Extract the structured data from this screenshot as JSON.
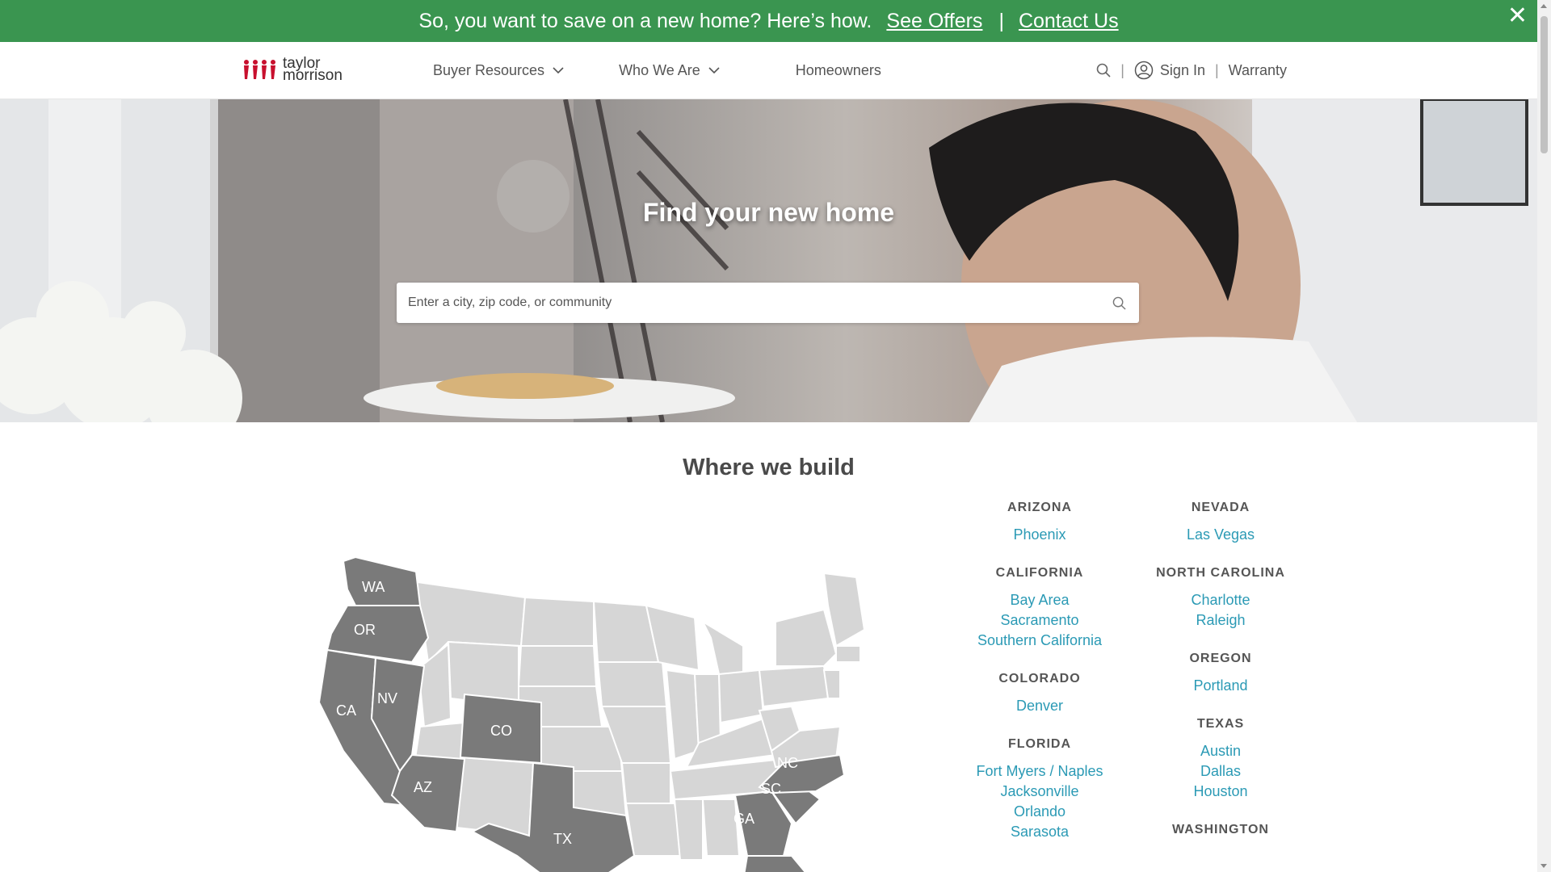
{
  "promo": {
    "text": "So, you want to save on a new home? Here’s how.",
    "offers_link": "See Offers",
    "separator": "|",
    "contact_link": "Contact Us",
    "close_glyph": "✕"
  },
  "header": {
    "logo_line1": "taylor",
    "logo_line2": "morrison",
    "nav": [
      {
        "label": "Buyer Resources"
      },
      {
        "label": "Who We Are"
      },
      {
        "label": "Homeowners"
      }
    ],
    "signin_label": "Sign In",
    "warranty_label": "Warranty"
  },
  "hero": {
    "title": "Find your new home",
    "search_placeholder": "Enter a city, zip code, or community"
  },
  "where_we_build": {
    "title": "Where we build",
    "map_highlighted_states": [
      "WA",
      "OR",
      "CA",
      "NV",
      "AZ",
      "CO",
      "TX",
      "GA",
      "SC",
      "NC"
    ],
    "col1": [
      {
        "state": "ARIZONA",
        "cities": [
          "Phoenix"
        ]
      },
      {
        "state": "CALIFORNIA",
        "cities": [
          "Bay Area",
          "Sacramento",
          "Southern California"
        ]
      },
      {
        "state": "COLORADO",
        "cities": [
          "Denver"
        ]
      },
      {
        "state": "FLORIDA",
        "cities": [
          "Fort Myers / Naples",
          "Jacksonville",
          "Orlando",
          "Sarasota"
        ]
      }
    ],
    "col2": [
      {
        "state": "NEVADA",
        "cities": [
          "Las Vegas"
        ]
      },
      {
        "state": "NORTH CAROLINA",
        "cities": [
          "Charlotte",
          "Raleigh"
        ]
      },
      {
        "state": "OREGON",
        "cities": [
          "Portland"
        ]
      },
      {
        "state": "TEXAS",
        "cities": [
          "Austin",
          "Dallas",
          "Houston"
        ]
      },
      {
        "state": "WASHINGTON",
        "cities": []
      }
    ]
  },
  "colors": {
    "banner_green": "#3a9550",
    "link_teal": "#2b9ab5",
    "map_highlight": "#7a7a7a",
    "map_default": "#d6d6d6",
    "logo_red": "#c8102e"
  }
}
